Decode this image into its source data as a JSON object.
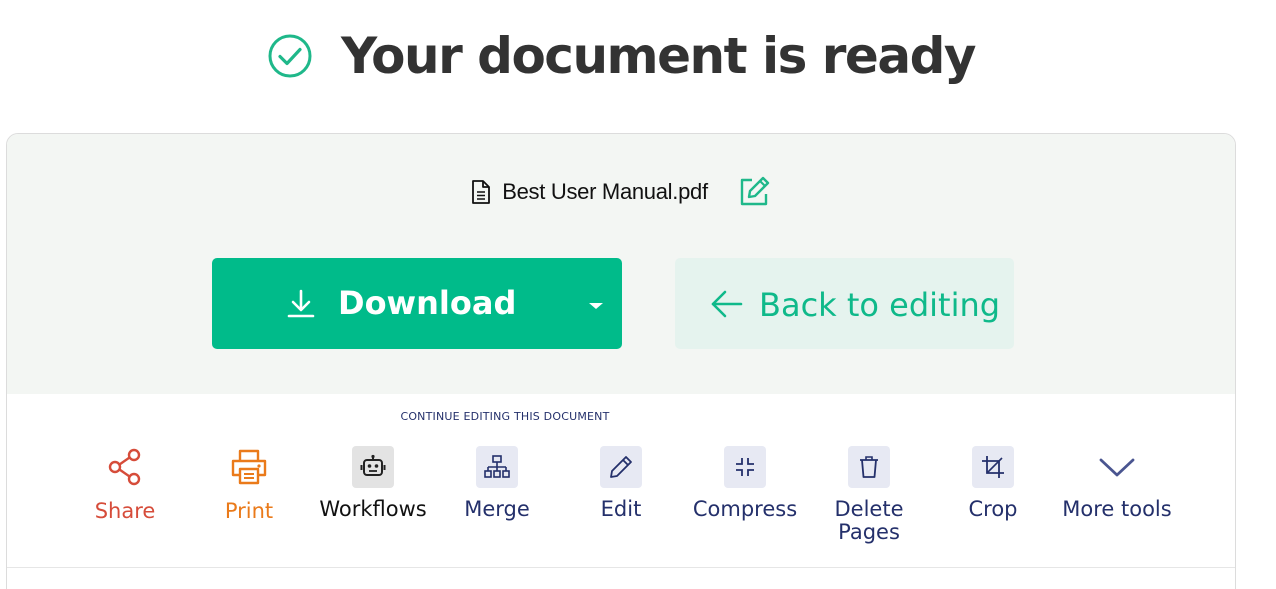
{
  "heading": {
    "title": "Your document is ready",
    "icon": "check-circle-icon",
    "icon_color": "#1fb88a"
  },
  "file": {
    "name": "Best User Manual.pdf",
    "icon": "document-icon",
    "edit_icon": "pencil-square-icon"
  },
  "download": {
    "label": "Download",
    "icon": "download-icon",
    "color": "#00bb8a"
  },
  "back": {
    "label": "Back to editing",
    "icon": "arrow-left-icon",
    "color": "#0fb98a"
  },
  "continue": {
    "label": "CONTINUE EDITING THIS DOCUMENT"
  },
  "tools": [
    {
      "id": "share",
      "label": "Share",
      "icon": "share-icon",
      "color": "#d64c3a"
    },
    {
      "id": "print",
      "label": "Print",
      "icon": "printer-icon",
      "color": "#ea7a1a"
    },
    {
      "id": "workflows",
      "label": "Workflows",
      "icon": "robot-icon"
    },
    {
      "id": "merge",
      "label": "Merge",
      "icon": "hierarchy-icon"
    },
    {
      "id": "edit",
      "label": "Edit",
      "icon": "pencil-icon"
    },
    {
      "id": "compress",
      "label": "Compress",
      "icon": "compress-icon"
    },
    {
      "id": "delete",
      "label": "Delete\nPages",
      "icon": "trash-icon"
    },
    {
      "id": "crop",
      "label": "Crop",
      "icon": "crop-icon"
    },
    {
      "id": "more",
      "label": "More tools",
      "icon": "chevron-down-icon"
    }
  ]
}
